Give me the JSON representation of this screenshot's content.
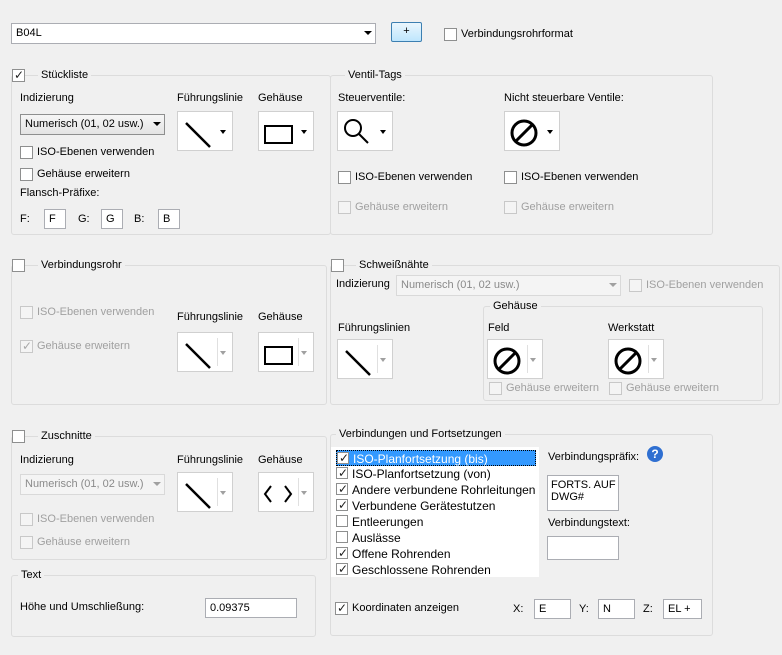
{
  "top": {
    "selector_value": "B04L",
    "add_button": "+",
    "pipe_format_label": "Verbindungsrohrformat"
  },
  "stueckliste": {
    "title": "Stückliste",
    "indexing_label": "Indizierung",
    "indexing_value": "Numerisch (01, 02 usw.)",
    "leader_label": "Führungslinie",
    "housing_label": "Gehäuse",
    "iso_layers": "ISO-Ebenen verwenden",
    "expand_housing": "Gehäuse erweitern",
    "flange_prefix_label": "Flansch-Präfixe:",
    "f_label": "F:",
    "f_value": "F",
    "g_label": "G:",
    "g_value": "G",
    "b_label": "B:",
    "b_value": "B"
  },
  "ventil": {
    "title": "Ventil-Tags",
    "control_label": "Steuerventile:",
    "noncontrol_label": "Nicht steuerbare Ventile:",
    "iso_layers_1": "ISO-Ebenen verwenden",
    "iso_layers_2": "ISO-Ebenen verwenden",
    "expand_housing_1": "Gehäuse erweitern",
    "expand_housing_2": "Gehäuse erweitern"
  },
  "verbindungsrohr": {
    "title": "Verbindungsrohr",
    "iso_layers": "ISO-Ebenen verwenden",
    "expand_housing": "Gehäuse erweitern",
    "leader_label": "Führungslinie",
    "housing_label": "Gehäuse"
  },
  "schweiss": {
    "title": "Schweißnähte",
    "indexing_label": "Indizierung",
    "indexing_value": "Numerisch (01, 02 usw.)",
    "iso_layers": "ISO-Ebenen verwenden",
    "leaders_label": "Führungslinien",
    "housing_group": "Gehäuse",
    "field_label": "Feld",
    "shop_label": "Werkstatt",
    "expand_housing_1": "Gehäuse erweitern",
    "expand_housing_2": "Gehäuse erweitern"
  },
  "zuschnitte": {
    "title": "Zuschnitte",
    "indexing_label": "Indizierung",
    "indexing_value": "Numerisch (01, 02 usw.)",
    "leader_label": "Führungslinie",
    "housing_label": "Gehäuse",
    "iso_layers": "ISO-Ebenen verwenden",
    "expand_housing": "Gehäuse erweitern"
  },
  "text": {
    "title": "Text",
    "height_label": "Höhe und Umschließung:",
    "height_value": "0.09375"
  },
  "connections": {
    "title": "Verbindungen und Fortsetzungen",
    "items": [
      {
        "label": "ISO-Planfortsetzung (bis)",
        "checked": true,
        "selected": true
      },
      {
        "label": "ISO-Planfortsetzung (von)",
        "checked": true,
        "selected": false
      },
      {
        "label": "Andere verbundene Rohrleitungen",
        "checked": true,
        "selected": false
      },
      {
        "label": "Verbundene Gerätestutzen",
        "checked": true,
        "selected": false
      },
      {
        "label": "Entleerungen",
        "checked": false,
        "selected": false
      },
      {
        "label": "Auslässe",
        "checked": false,
        "selected": false
      },
      {
        "label": "Offene Rohrenden",
        "checked": true,
        "selected": false
      },
      {
        "label": "Geschlossene Rohrenden",
        "checked": true,
        "selected": false
      }
    ],
    "prefix_label": "Verbindungspräfix:",
    "prefix_value_line1": "FORTS. AUF",
    "prefix_value_line2": "DWG#",
    "text_label": "Verbindungstext:",
    "text_value": "",
    "coords_label": "Koordinaten anzeigen",
    "x_label": "X:",
    "x_value": "E",
    "y_label": "Y:",
    "y_value": "N",
    "z_label": "Z:",
    "z_value": "EL +"
  },
  "icons": {
    "diagonal-line": "diagonal-line-icon",
    "rectangle": "rectangle-icon",
    "magnifier": "magnifier-icon",
    "no-symbol": "no-symbol-icon",
    "angle-brackets": "angle-brackets-icon",
    "help": "help-icon"
  },
  "colors": {
    "background": "#f0f0f0",
    "selection": "#3399ff",
    "help": "#2f6fd1"
  }
}
